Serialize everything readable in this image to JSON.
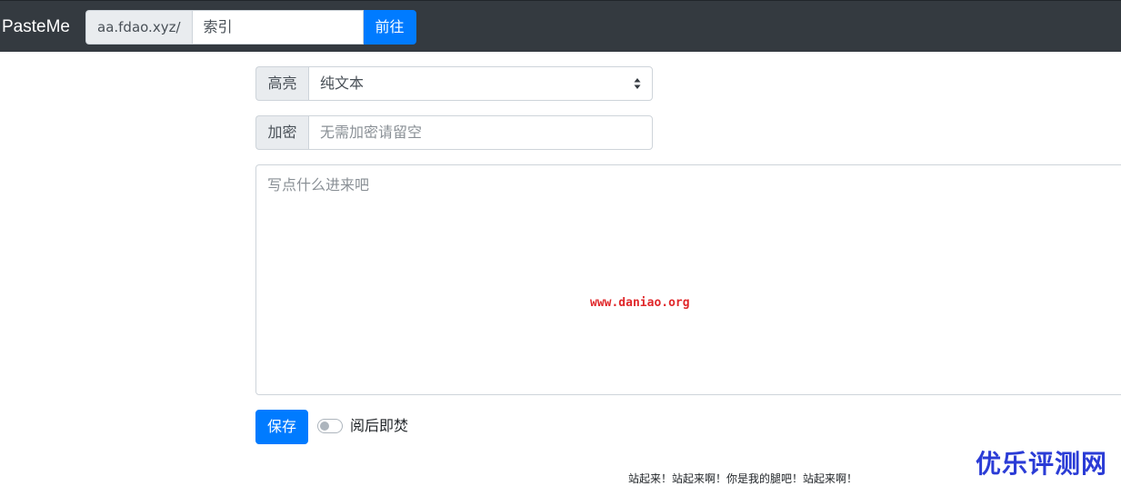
{
  "navbar": {
    "brand": "PasteMe",
    "url_prefix": "aa.fdao.xyz/",
    "index_placeholder": "索引",
    "go_label": "前往"
  },
  "form": {
    "highlight_label": "高亮",
    "highlight_value": "纯文本",
    "password_label": "加密",
    "password_placeholder": "无需加密请留空",
    "content_placeholder": "写点什么进来吧",
    "save_label": "保存",
    "burn_after_read_label": "阅后即焚",
    "burn_after_read_on": false
  },
  "watermark": {
    "url": "www.daniao.org",
    "corner_text": "优乐评测网"
  },
  "footer": {
    "text": "站起来！站起来啊！你是我的腿吧！站起来啊！"
  },
  "colors": {
    "navbar_bg": "#343a40",
    "primary": "#007bff",
    "watermark_red": "#e0282b",
    "watermark_blue": "#2b3cd6"
  }
}
